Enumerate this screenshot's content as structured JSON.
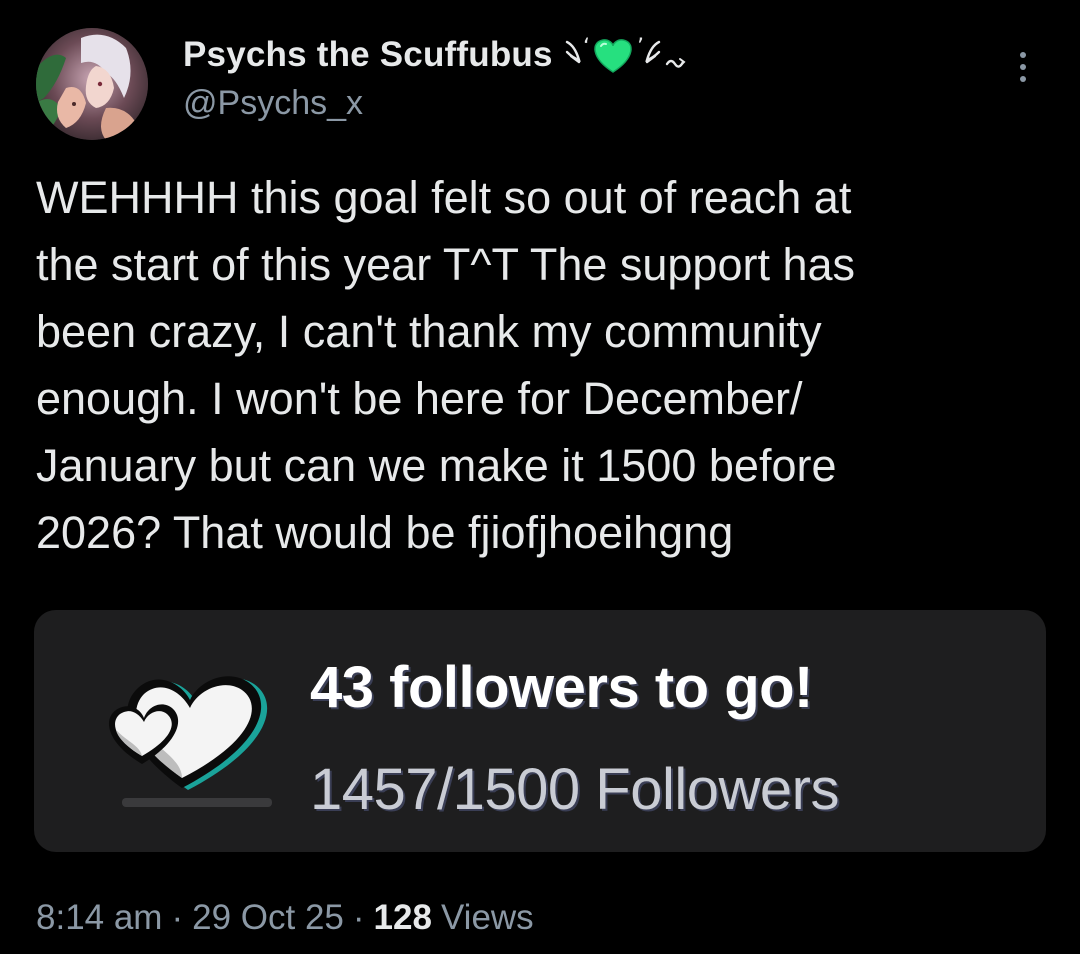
{
  "author": {
    "display_name": "Psychs the Scuffubus",
    "name_decoration": "ribbon-heart-emoji",
    "handle": "@Psychs_x",
    "avatar": "avatar-image"
  },
  "menu": {
    "icon": "more-vertical-icon"
  },
  "post": {
    "text": "WEHHHH this goal felt so out of reach at\nthe start of this year T^T The support has\nbeen crazy, I can't thank my community\nenough. I won't be here for December/\nJanuary but can we make it 1500 before\n2026? That would be fjiofjhoeihgng"
  },
  "goal_card": {
    "icon": "double-heart-icon",
    "title": "43 followers to go!",
    "progress_text": "1457/1500 Followers",
    "current": 1457,
    "target": 1500
  },
  "meta": {
    "time": "8:14 am",
    "separator": "·",
    "date": "29 Oct 25",
    "views_count": "128",
    "views_label": "Views"
  },
  "colors": {
    "background": "#000000",
    "primary_text": "#e7e9ea",
    "secondary_text": "#8b98a5",
    "card_background": "#1e1e1f",
    "heart_accent": "#3fd08a",
    "heart_outline_teal": "#1aa39a"
  }
}
